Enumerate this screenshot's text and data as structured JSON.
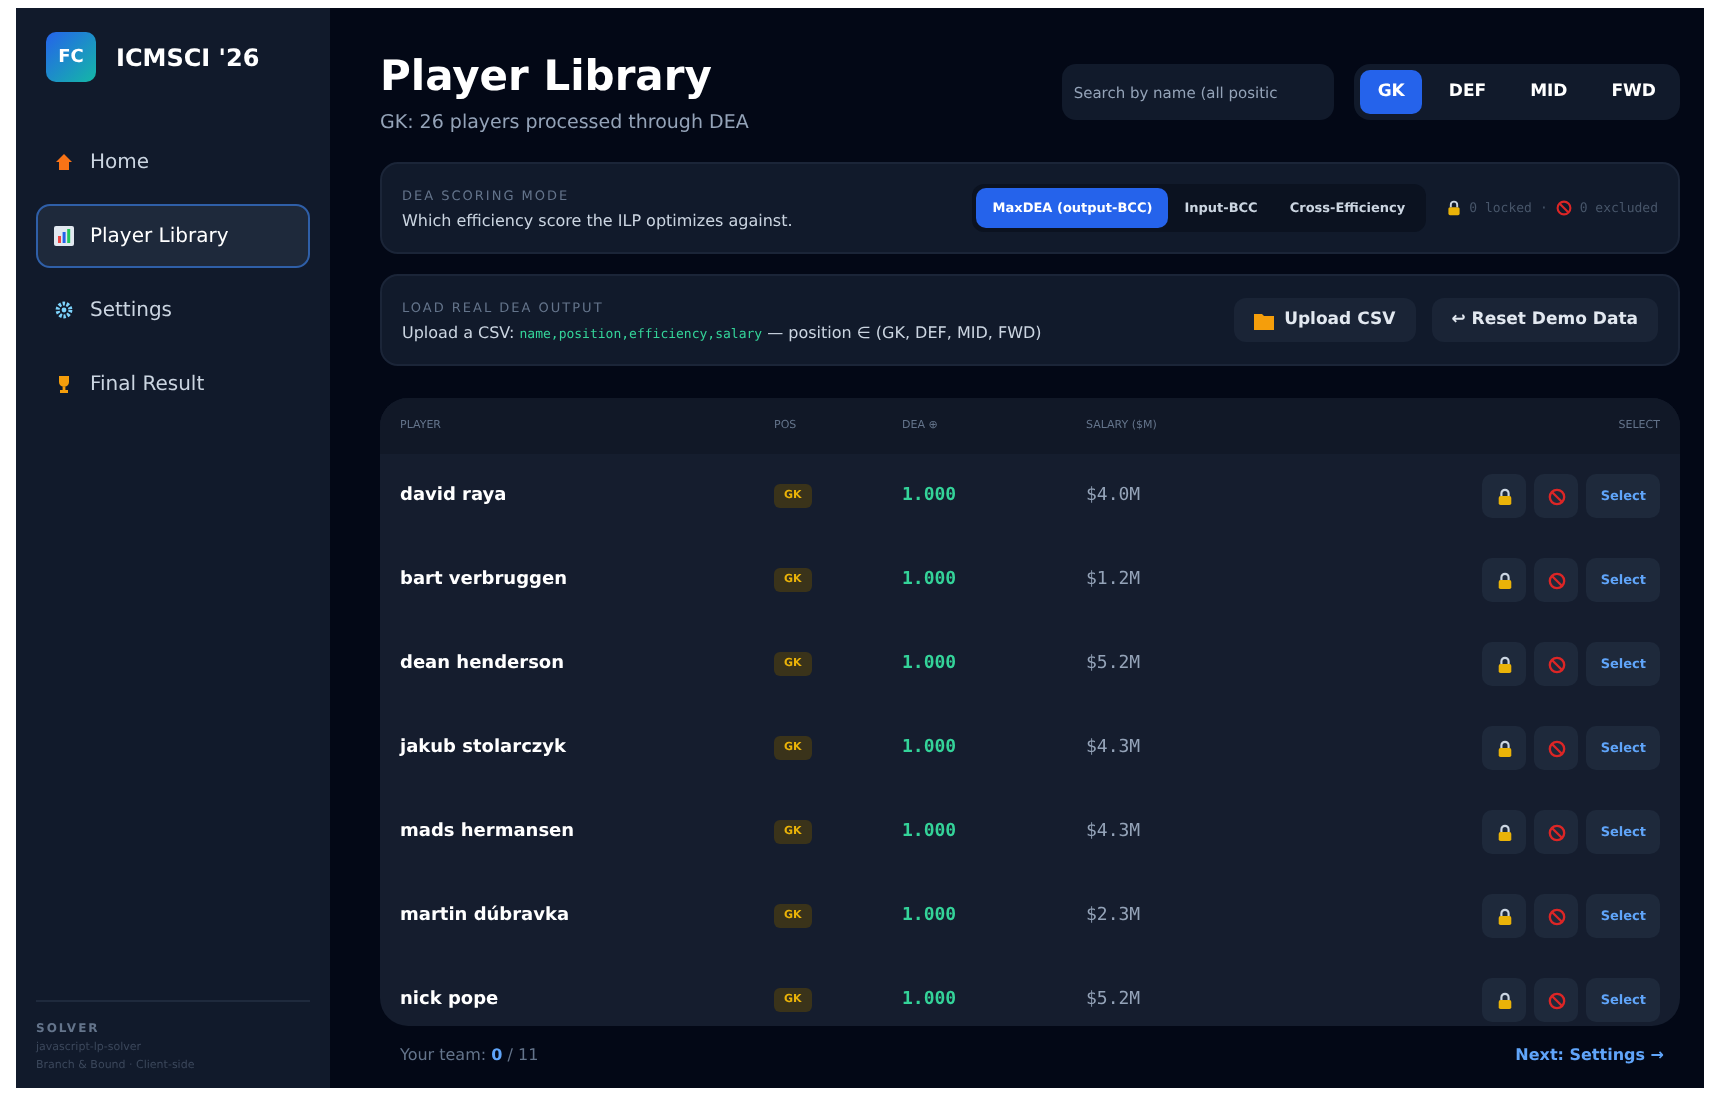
{
  "brand": {
    "logo": "FC",
    "name": "ICMSCI '26"
  },
  "nav": [
    {
      "label": "Home",
      "selected": false
    },
    {
      "label": "Player Library",
      "selected": true
    },
    {
      "label": "Settings",
      "selected": false
    },
    {
      "label": "Final Result",
      "selected": false
    }
  ],
  "solver": {
    "title": "SOLVER",
    "lines": [
      "javascript-lp-solver",
      "Branch & Bound · Client-side"
    ]
  },
  "header": {
    "title": "Player Library",
    "subtitle": "GK: 26 players processed through DEA"
  },
  "search": {
    "placeholder": "Search by name (all positic"
  },
  "positions": [
    {
      "label": "GK",
      "selected": true
    },
    {
      "label": "DEF",
      "selected": false
    },
    {
      "label": "MID",
      "selected": false
    },
    {
      "label": "FWD",
      "selected": false
    }
  ],
  "scoring": {
    "title": "DEA SCORING MODE",
    "description": "Which efficiency score the ILP optimizes against.",
    "modes": [
      {
        "label": "MaxDEA (output-BCC)",
        "selected": true
      },
      {
        "label": "Input-BCC",
        "selected": false
      },
      {
        "label": "Cross-Efficiency",
        "selected": false
      }
    ],
    "locked": "0 locked",
    "separator": "·",
    "excluded": "0 excluded"
  },
  "upload": {
    "title": "LOAD REAL DEA OUTPUT",
    "prefix": "Upload a CSV: ",
    "fields": "name,position,efficiency,salary",
    "suffix": " — position ∈ (GK, DEF, MID, FWD)",
    "upload_button": "Upload CSV",
    "reset_button": "↩ Reset Demo Data"
  },
  "table": {
    "columns": [
      "PLAYER",
      "POS",
      "DEA ⊕",
      "SALARY ($M)",
      "SELECT"
    ],
    "rows": [
      {
        "name": "david raya",
        "pos": "GK",
        "dea": "1.000",
        "salary": "$4.0M",
        "action": "Select"
      },
      {
        "name": "bart verbruggen",
        "pos": "GK",
        "dea": "1.000",
        "salary": "$1.2M",
        "action": "Select"
      },
      {
        "name": "dean henderson",
        "pos": "GK",
        "dea": "1.000",
        "salary": "$5.2M",
        "action": "Select"
      },
      {
        "name": "jakub stolarczyk",
        "pos": "GK",
        "dea": "1.000",
        "salary": "$4.3M",
        "action": "Select"
      },
      {
        "name": "mads hermansen",
        "pos": "GK",
        "dea": "1.000",
        "salary": "$4.3M",
        "action": "Select"
      },
      {
        "name": "martin dúbravka",
        "pos": "GK",
        "dea": "1.000",
        "salary": "$2.3M",
        "action": "Select"
      },
      {
        "name": "nick pope",
        "pos": "GK",
        "dea": "1.000",
        "salary": "$5.2M",
        "action": "Select"
      }
    ]
  },
  "footer": {
    "team_label": "Your team: ",
    "team_count": "0",
    "team_total": " / 11",
    "next": "Next: Settings →"
  }
}
